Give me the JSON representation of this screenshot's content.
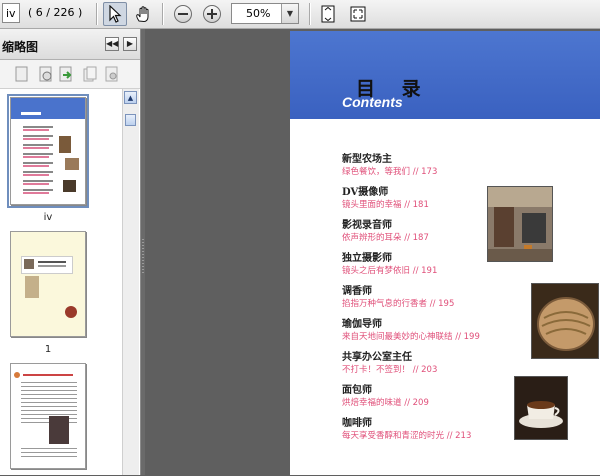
{
  "toolbar": {
    "page_input": "iv",
    "page_count": "( 6 / 226 )",
    "zoom": "50%"
  },
  "sidebar": {
    "title": "缩略图",
    "thumbnails": [
      {
        "label": "iv",
        "selected": true
      },
      {
        "label": "1",
        "selected": false
      },
      {
        "label": "",
        "selected": false
      }
    ]
  },
  "document": {
    "banner_cn": "目 录",
    "banner_en": "Contents",
    "toc": [
      {
        "title": "新型农场主",
        "sub": "绿色餐饮，等我们 // 173"
      },
      {
        "title": "DV摄像师",
        "sub": "镜头里面的幸福 // 181"
      },
      {
        "title": "影视录音师",
        "sub": "依声辨形的耳朵 // 187"
      },
      {
        "title": "独立摄影师",
        "sub": "镜头之后有梦依旧 // 191"
      },
      {
        "title": "调香师",
        "sub": "掐指万种气息的行香者 // 195"
      },
      {
        "title": "瑜伽导师",
        "sub": "来自天地间最美妙的心神联结 // 199"
      },
      {
        "title": "共享办公室主任",
        "sub": "不打卡！不签到！ // 203"
      },
      {
        "title": "面包师",
        "sub": "烘焙幸福的味道 // 209"
      },
      {
        "title": "咖啡师",
        "sub": "每天享受香醇和青涩的时光 // 213"
      }
    ]
  },
  "colors": {
    "banner": "#4270c8",
    "toc_sub": "#e0507a",
    "toolbar_bg": "#e8e8e8",
    "workspace": "#5f5f5f"
  },
  "icons": [
    "select-arrow-icon",
    "hand-icon",
    "zoom-out-icon",
    "zoom-in-icon",
    "zoom-dropdown-icon",
    "fit-page-icon",
    "fit-window-icon",
    "collapse-panel-icon",
    "panel-options-icon"
  ]
}
